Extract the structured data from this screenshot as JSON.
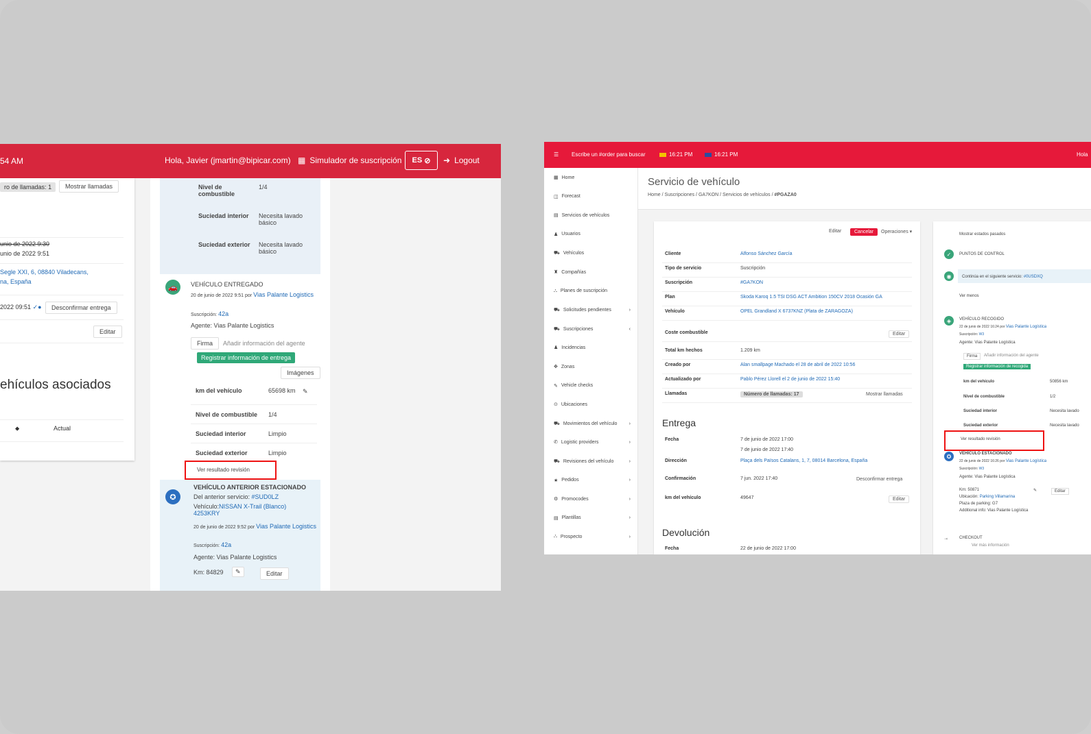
{
  "left": {
    "topbar": {
      "clock": "54 AM",
      "greeting": "Hola, Javier (jmartin@bipicar.com)",
      "simulator": "Simulador de suscripción",
      "lang": "ES",
      "logout": "Logout"
    },
    "card1": {
      "calls_pill": "ro de llamadas:",
      "calls_count": "1",
      "show_calls": "Mostrar llamadas",
      "date_struck": "unio de 2022 9:30",
      "date_new": "unio de 2022 9:51",
      "address_line1": "Segle XXI, 6, 08840 Viladecans,",
      "address_line2": "na, España",
      "confirm_time": "2022 09:51",
      "unconfirm_btn": "Desconfirmar entrega",
      "edit_btn": "Editar",
      "assoc_heading": "ehículos asociados",
      "row_arrow": "⬥",
      "row_current": "Actual"
    },
    "timeline": {
      "fuel_label": "Nivel de combustible",
      "fuel_value": "1/4",
      "int_dirt_label": "Suciedad interior",
      "int_dirt_value": "Necesita lavado básico",
      "ext_dirt_label": "Suciedad exterior",
      "ext_dirt_value": "Necesita lavado básico",
      "delivered_title": "VEHÍCULO ENTREGADO",
      "delivered_date": "20 de junio de 2022 9:51",
      "por": "por",
      "agent_link": "Vias Palante Logistics",
      "subscription_label": "Suscripción:",
      "subscription_value": "42a",
      "agent_line": "Agente: Vias Palante Logistics",
      "firma_tab": "Firma",
      "add_agent_info": "Añadir información del agente",
      "register_btn": "Registrar información de entrega",
      "images_btn": "Imágenes",
      "km_label": "km del vehículo",
      "km_value": "65698 km",
      "fuel2_label": "Nivel de combustible",
      "fuel2_value": "1/4",
      "int2_label": "Suciedad interior",
      "int2_value": "Limpio",
      "ext2_label": "Suciedad exterior",
      "ext2_value": "Limpio",
      "review_btn": "Ver resultado revisión",
      "parked_title": "VEHÍCULO ANTERIOR ESTACIONADO",
      "prev_service": "Del anterior servicio:",
      "prev_service_link": "#SUD0LZ",
      "vehicle_label": "Vehículo:",
      "vehicle_link": "NISSAN X-Trail (Blanco) 4253KRY",
      "parked_date": "20 de junio de 2022 9:52",
      "agent_link2": "Vias Palante Logistics",
      "subscription_value2": "42a",
      "agent_line2": "Agente: Vias Palante Logistics",
      "km_line": "Km: 84829",
      "edit2": "Editar"
    }
  },
  "right": {
    "topbar": {
      "search_placeholder": "Escribe un #order para buscar",
      "time1": "16:21 PM",
      "time2": "16:21 PM",
      "hello": "Hola"
    },
    "sidebar": [
      {
        "label": "Home",
        "chev": ""
      },
      {
        "label": "Forecast",
        "chev": ""
      },
      {
        "label": "Servicios de vehículos",
        "chev": ""
      },
      {
        "label": "Usuarios",
        "chev": ""
      },
      {
        "label": "Vehículos",
        "chev": ""
      },
      {
        "label": "Compañías",
        "chev": ""
      },
      {
        "label": "Planes de suscripción",
        "chev": ""
      },
      {
        "label": "Solicitudes pendientes",
        "chev": "›"
      },
      {
        "label": "Suscripciones",
        "chev": "‹"
      },
      {
        "label": "Incidencias",
        "chev": ""
      },
      {
        "label": "Zonas",
        "chev": ""
      },
      {
        "label": "Vehicle checks",
        "chev": ""
      },
      {
        "label": "Ubicaciones",
        "chev": ""
      },
      {
        "label": "Movimientos del vehículo",
        "chev": "›"
      },
      {
        "label": "Logistic providers",
        "chev": "›"
      },
      {
        "label": "Revisiones del vehículo",
        "chev": "›"
      },
      {
        "label": "Pedidos",
        "chev": "›"
      },
      {
        "label": "Promocodes",
        "chev": "›"
      },
      {
        "label": "Plantillas",
        "chev": "›"
      },
      {
        "label": "Prospecto",
        "chev": "›"
      }
    ],
    "header": {
      "title": "Servicio de vehículo",
      "crumb1": "Home",
      "crumb2": "Suscripciones",
      "crumb3": "GA7KON",
      "crumb4": "Servicios de vehículos",
      "crumb5": "#PGAZA0"
    },
    "card": {
      "edit": "Editar",
      "cancel": "Cancelar",
      "ops": "Operaciones ▾",
      "rows": [
        {
          "k": "Cliente",
          "v": "Alfonso Sánchez García"
        },
        {
          "k": "Tipo de servicio",
          "v": "Suscripción"
        },
        {
          "k": "Suscripción",
          "v": "#GA7KON"
        },
        {
          "k": "Plan",
          "v": "Skoda Karoq 1.5 TSI DSG ACT Ambition 150CV 2018 Ocasión GA"
        },
        {
          "k": "Vehículo",
          "v": "OPEL Grandland X 6737KNZ (Plata de ZARAGOZA)"
        },
        {
          "k": "Coste combustible",
          "v": ""
        },
        {
          "k": "Total km hechos",
          "v": "1.209 km"
        },
        {
          "k": "Creado por",
          "v": "Alan smallpage Machado el 28 de abril de 2022 10:56"
        },
        {
          "k": "Actualizado por",
          "v": "Pablo Pérez Llorell el 2 de junio de 2022 15:40"
        },
        {
          "k": "Llamadas",
          "v": ""
        }
      ],
      "edit_fuel": "Editar",
      "calls_pill": "Número de llamadas: 17",
      "show_calls": "Mostrar llamadas",
      "entrega_title": "Entrega",
      "entrega_rows": [
        {
          "k": "Fecha",
          "v": "7 de junio de 2022 17:00"
        },
        {
          "k": "Dirección",
          "v": "Plaça dels Països Catalans, 1, 7, 08014 Barcelona, España"
        },
        {
          "k": "Confirmación",
          "v": "7 jun. 2022 17:40"
        },
        {
          "k": "km del vehículo",
          "v": "49647"
        }
      ],
      "fecha2": "7 de junio de 2022 17:40",
      "unconfirm": "Desconfirmar entrega",
      "edit_km": "Editar",
      "devolucion_title": "Devolución",
      "dev_fecha_k": "Fecha",
      "dev_fecha_v": "22 de junio de 2022 17:00"
    },
    "timeline": {
      "show_past": "Mostrar estados pasados",
      "checkpoints": "PUNTOS DE CONTROL",
      "continue": "Continúa en el siguiente servicio:",
      "continue_link": "#0USDXQ",
      "show_less": "Ver menos",
      "picked": "VEHÍCULO RECOGIDO",
      "picked_date": "22 de junio de 2022 16:24",
      "por": "por",
      "agent_link": "Vias Palante Logística",
      "sub_label": "Suscripción:",
      "sub_val": "W3",
      "agent_line": "Agente: Vias Palante Logística",
      "firma": "Firma",
      "add_info": "Añadir información del agente",
      "register": "Registrar información de recogida",
      "km_k": "km del vehículo",
      "km_v": "50856 km",
      "fuel_k": "Nivel de combustible",
      "fuel_v": "1/2",
      "int_k": "Suciedad interior",
      "int_v": "Necesita lavado",
      "ext_k": "Suciedad exterior",
      "ext_v": "Necesita lavado",
      "review": "Ver resultado revisión",
      "parked": "VEHÍCULO ESTACIONADO",
      "parked_date": "22 de junio de 2022 16:26",
      "agent_link2": "Vias Palante Logística",
      "sub_val2": "W3",
      "agent_line2": "Agente: Vias Palante Logística",
      "km_line": "Km: 50871",
      "location_k": "Ubicación:",
      "location_v": "Parking Villamarina",
      "place": "Plaza de parking: G7",
      "extra": "Additional info: Vias Palante Logística",
      "edit": "Editar",
      "checkout": "CHECKOUT",
      "checkout_sub": "Ver más información"
    }
  }
}
